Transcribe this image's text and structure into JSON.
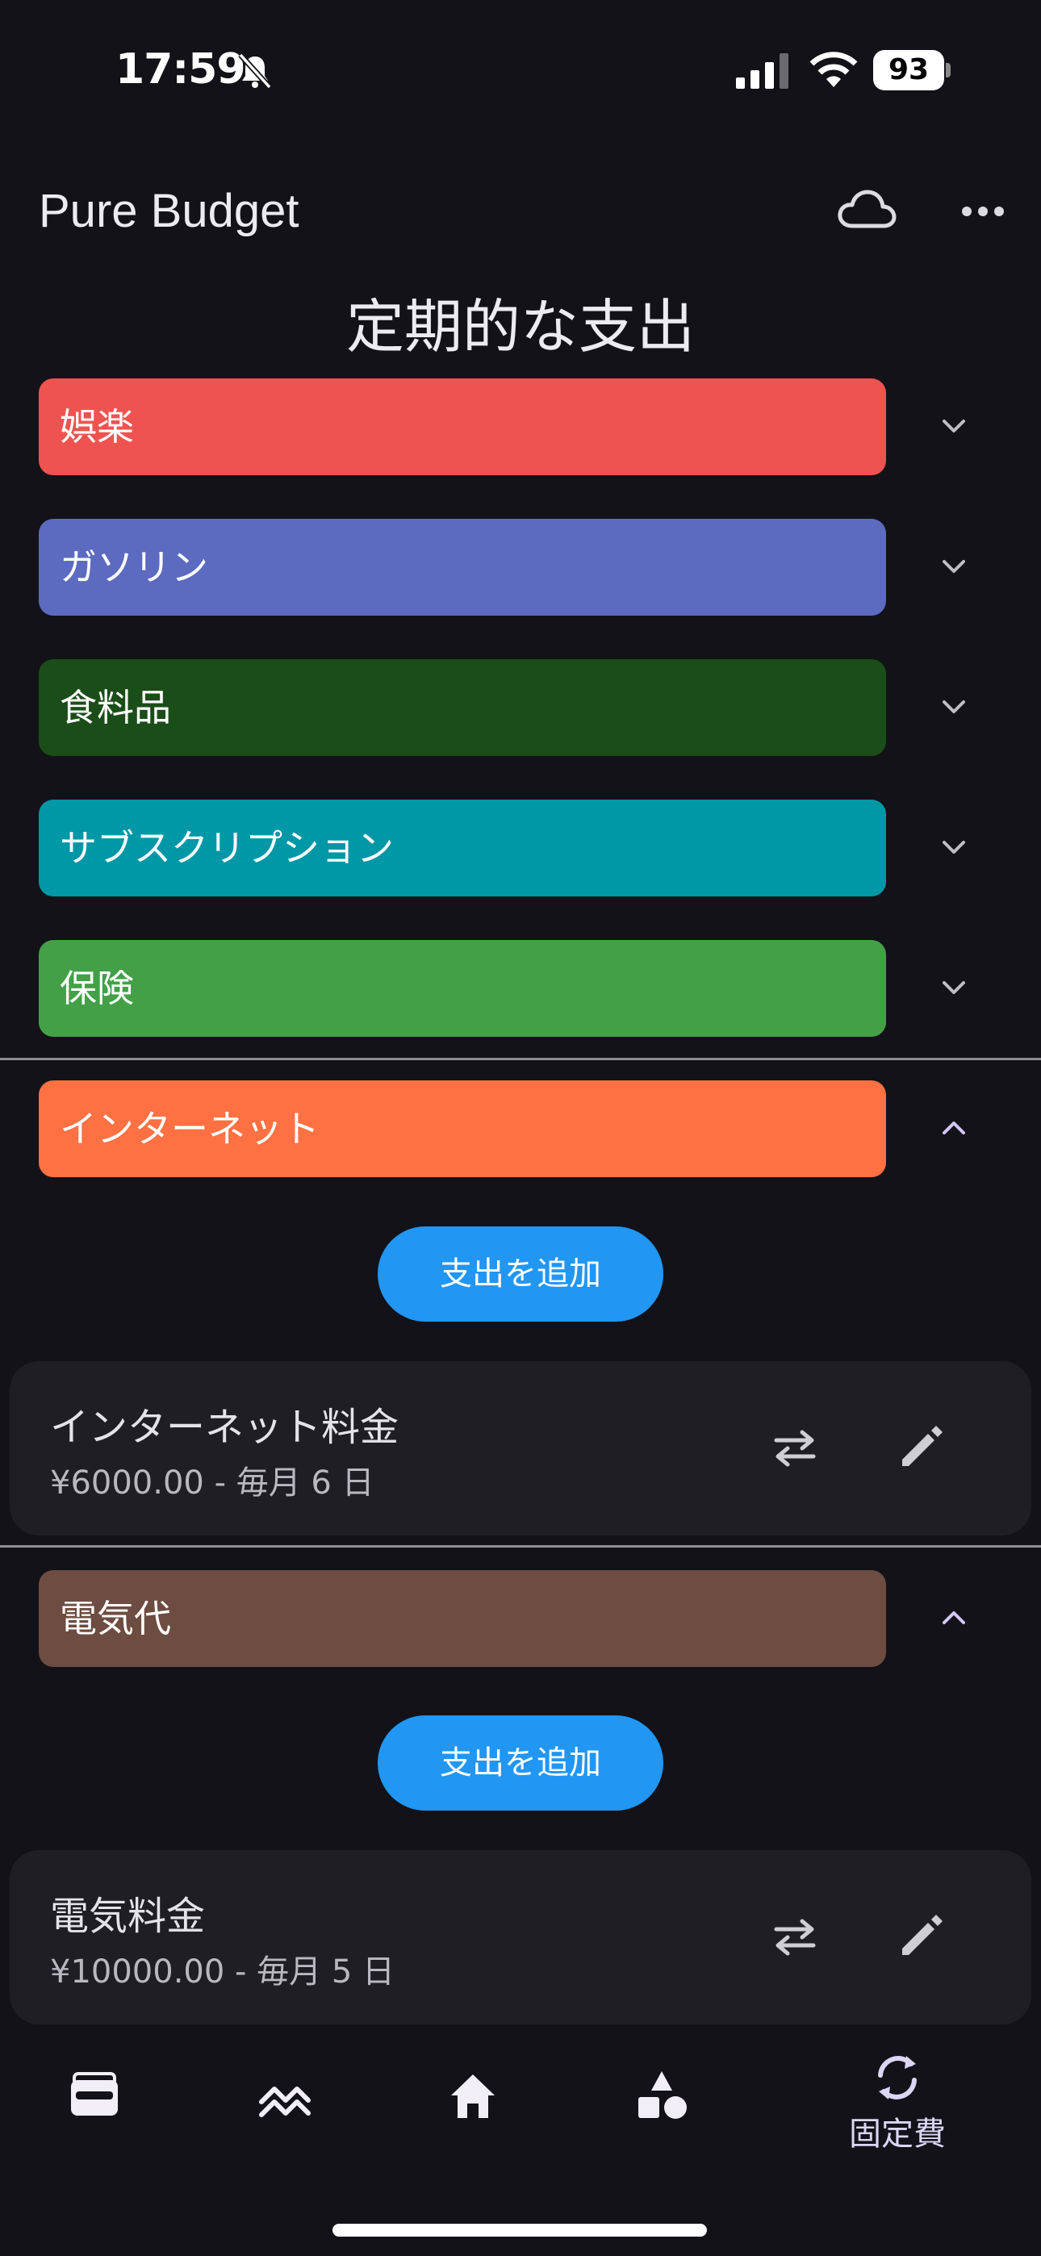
{
  "status_bar": {
    "time": "17:59",
    "battery": "93"
  },
  "app_bar": {
    "title": "Pure Budget"
  },
  "page": {
    "title": "定期的な支出"
  },
  "categories": [
    {
      "name": "娯楽",
      "color": "#ef5350",
      "expanded": false
    },
    {
      "name": "ガソリン",
      "color": "#5c6bc0",
      "expanded": false
    },
    {
      "name": "食料品",
      "color": "#1b4d18",
      "expanded": false
    },
    {
      "name": "サブスクリプション",
      "color": "#0097a7",
      "expanded": false
    },
    {
      "name": "保険",
      "color": "#43a047",
      "expanded": false
    },
    {
      "name": "インターネット",
      "color": "#ff7043",
      "expanded": true
    },
    {
      "name": "電気代",
      "color": "#6d4c41",
      "expanded": true
    }
  ],
  "add_expense_label": "支出を追加",
  "expenses": [
    {
      "name": "インターネット料金",
      "detail": "¥6000.00 - 毎月 6 日"
    },
    {
      "name": "電気料金",
      "detail": "¥10000.00 - 毎月 5 日"
    }
  ],
  "bottom_nav": {
    "items": [
      "wallet-icon",
      "trend-icon",
      "home-icon",
      "shapes-icon",
      "recurring-icon"
    ],
    "active_label": "固定費"
  },
  "colors": {
    "background": "#131218",
    "accent_blue": "#2196f3",
    "chevron_active": "#d4c6f7"
  }
}
